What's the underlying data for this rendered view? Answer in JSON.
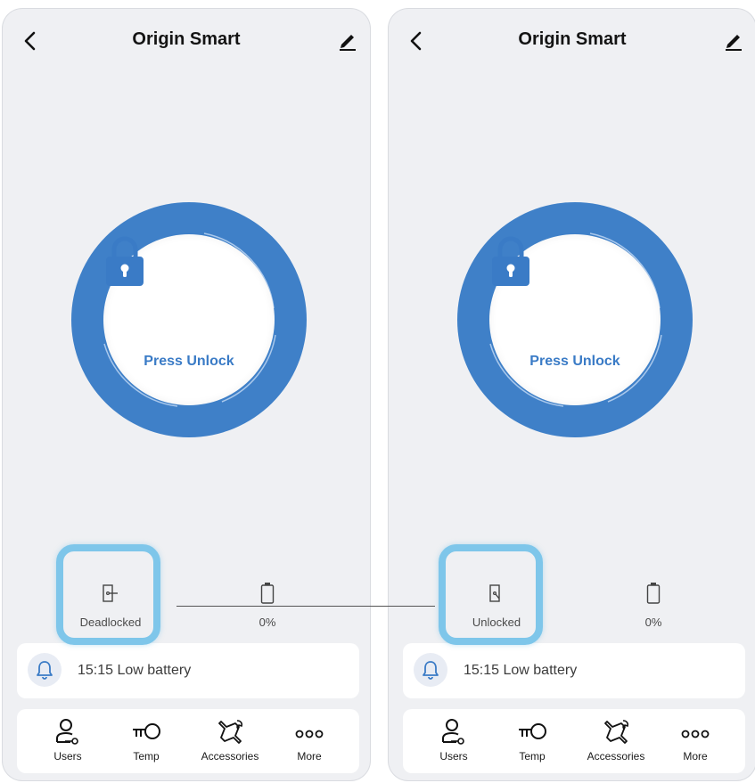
{
  "colors": {
    "accent": "#3a7bc6",
    "ring": "#4080c8",
    "highlight": "#7ec6ea",
    "panel_bg": "#eff0f3"
  },
  "phones": [
    {
      "title": "Origin Smart",
      "button_label": "Press Unlock",
      "lock_status": "Deadlocked",
      "battery": "0%",
      "notice": "15:15 Low battery",
      "tabs": [
        {
          "label": "Users",
          "icon": "users-icon"
        },
        {
          "label": "Temp",
          "icon": "key-icon"
        },
        {
          "label": "Accessories",
          "icon": "tools-icon"
        },
        {
          "label": "More",
          "icon": "more-icon"
        }
      ]
    },
    {
      "title": "Origin Smart",
      "button_label": "Press Unlock",
      "lock_status": "Unlocked",
      "battery": "0%",
      "notice": "15:15 Low battery",
      "tabs": [
        {
          "label": "Users",
          "icon": "users-icon"
        },
        {
          "label": "Temp",
          "icon": "key-icon"
        },
        {
          "label": "Accessories",
          "icon": "tools-icon"
        },
        {
          "label": "More",
          "icon": "more-icon"
        }
      ]
    }
  ]
}
